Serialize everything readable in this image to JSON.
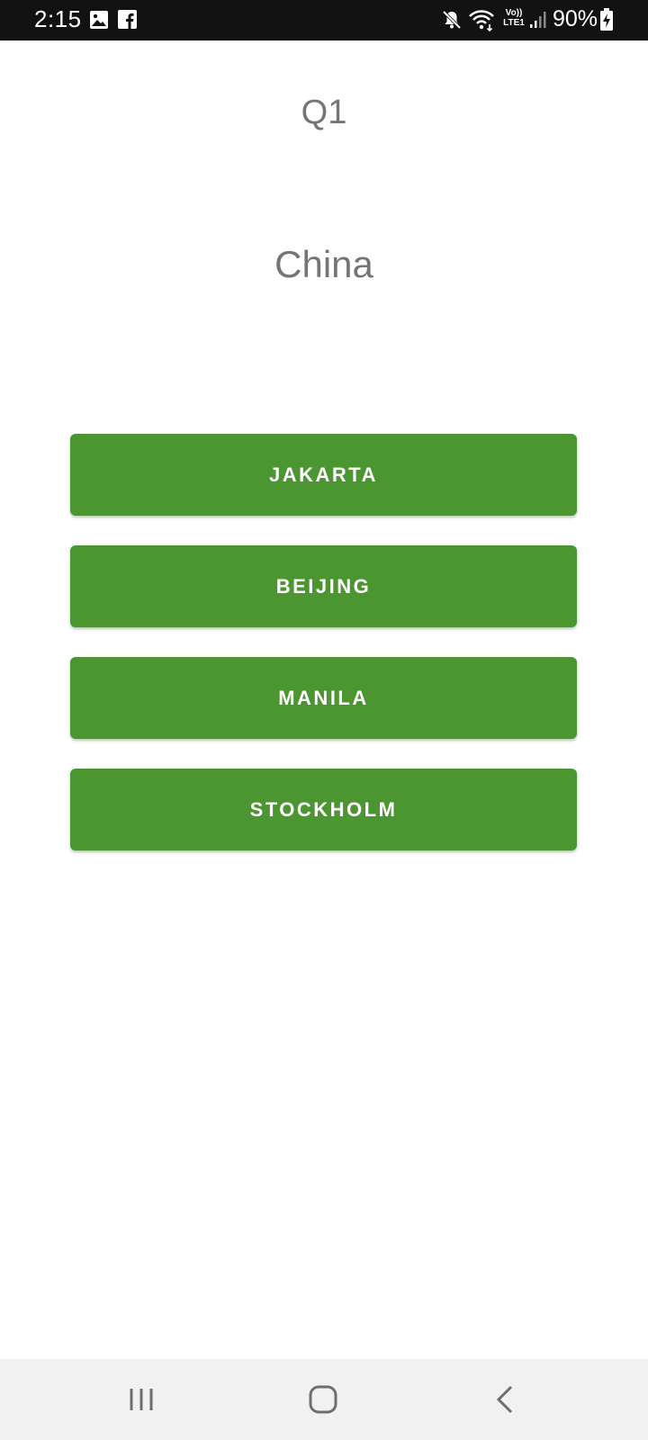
{
  "status_bar": {
    "time": "2:15",
    "battery": "90%",
    "icons": [
      "gallery-icon",
      "facebook-icon",
      "mute-icon",
      "wifi-icon",
      "volte-lte-icon",
      "signal-icon",
      "battery-charging-icon"
    ],
    "volte_label_top": "Vo))",
    "volte_label_bottom": "LTE1"
  },
  "quiz": {
    "question_number": "Q1",
    "country": "China",
    "answers": [
      "JAKARTA",
      "BEIJING",
      "MANILA",
      "STOCKHOLM"
    ]
  },
  "nav_bar": {
    "buttons": [
      "recents-icon",
      "home-icon",
      "back-icon"
    ]
  },
  "colors": {
    "accent": "#4c9632",
    "status_bar": "#121212",
    "text_gray": "#757575",
    "nav_bar": "#f1f1f1"
  }
}
